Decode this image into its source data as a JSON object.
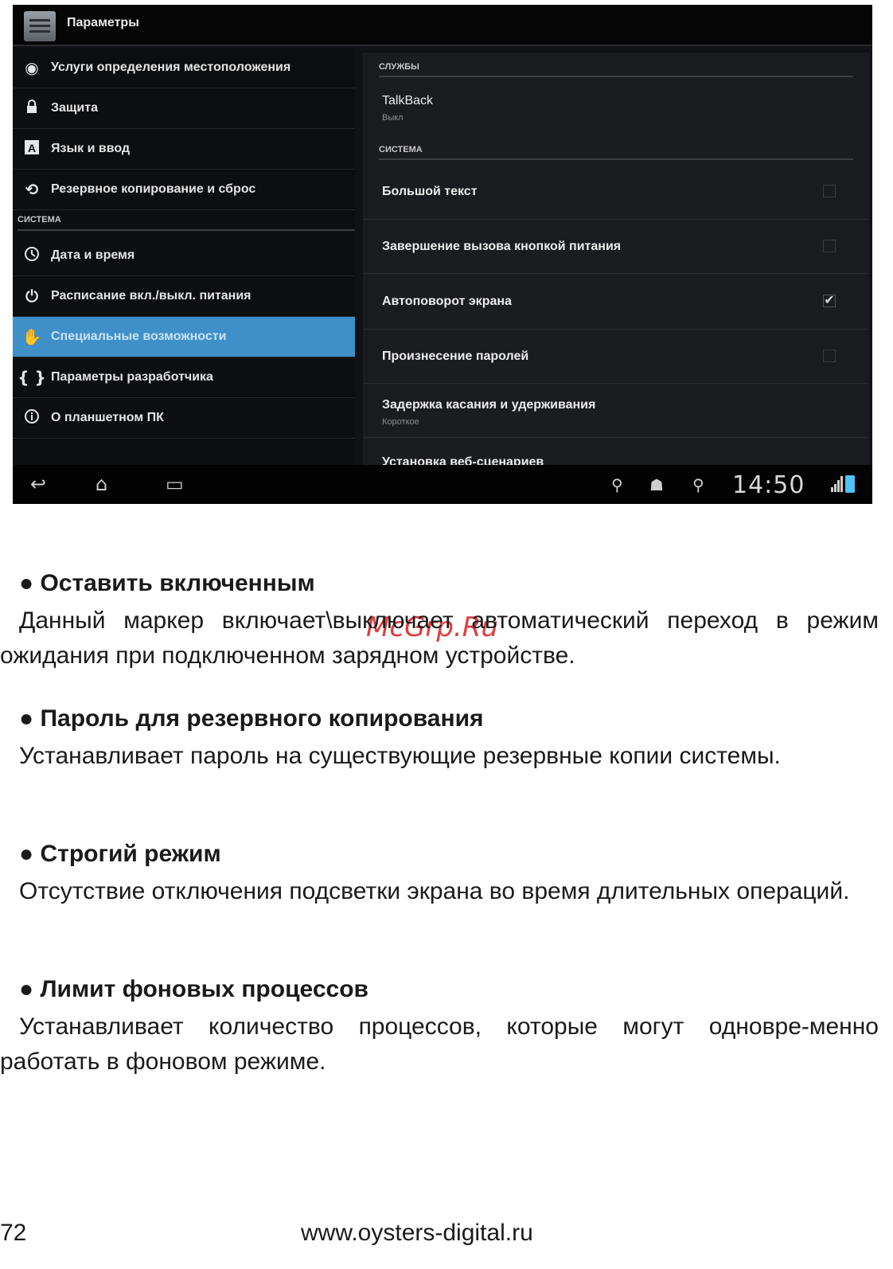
{
  "screenshot": {
    "title": "Параметры",
    "left_menu": [
      {
        "icon": "location-icon",
        "label": "Услуги определения местоположения"
      },
      {
        "icon": "lock-icon",
        "label": "Защита"
      },
      {
        "icon": "keyboard-icon",
        "label": "Язык и ввод"
      },
      {
        "icon": "backup-icon",
        "label": "Резервное копирование и сброс"
      }
    ],
    "left_section_header": "СИСТЕМА",
    "left_system_menu": [
      {
        "icon": "clock-icon",
        "label": "Дата и время"
      },
      {
        "icon": "power-schedule-icon",
        "label": "Расписание вкл./выкл. питания"
      },
      {
        "icon": "hand-icon",
        "label": "Специальные возможности",
        "selected": true
      },
      {
        "icon": "braces-icon",
        "label": "Параметры разработчика"
      },
      {
        "icon": "info-icon",
        "label": "О планшетном ПК"
      }
    ],
    "right_header_services": "СЛУЖБЫ",
    "talkback": {
      "title": "TalkBack",
      "subtitle": "Выкл"
    },
    "right_header_system": "СИСТЕМА",
    "right_items": [
      {
        "title": "Большой текст",
        "checked": false
      },
      {
        "title": "Завершение вызова кнопкой питания",
        "checked": false
      },
      {
        "title": "Автоповорот экрана",
        "checked": true
      },
      {
        "title": "Произнесение паролей",
        "checked": false
      }
    ],
    "touch_delay": {
      "title": "Задержка касания и удерживания",
      "subtitle": "Короткое"
    },
    "web_scripts": {
      "title": "Установка веб-сценариев"
    },
    "status_bar": {
      "time": "14:50"
    },
    "accent_color": "#3f8fc9"
  },
  "watermark": "McGrp.Ru",
  "sections": [
    {
      "heading": "● Оставить включенным",
      "text": "Данный маркер включает\\выключает автоматический переход в режим ожидания при подключенном зарядном устройстве."
    },
    {
      "heading": "● Пароль для резервного копирования",
      "text": "Устанавливает пароль на существующие резервные копии системы."
    },
    {
      "heading": "● Строгий режим",
      "text": "Отсутствие отключения подсветки экрана во время длительных операций."
    },
    {
      "heading": "● Лимит фоновых процессов",
      "text": "Устанавливает количество процессов, которые могут одновре-менно работать в фоновом режиме."
    }
  ],
  "footer": {
    "page_number": "72",
    "url": "www.oysters-digital.ru"
  }
}
